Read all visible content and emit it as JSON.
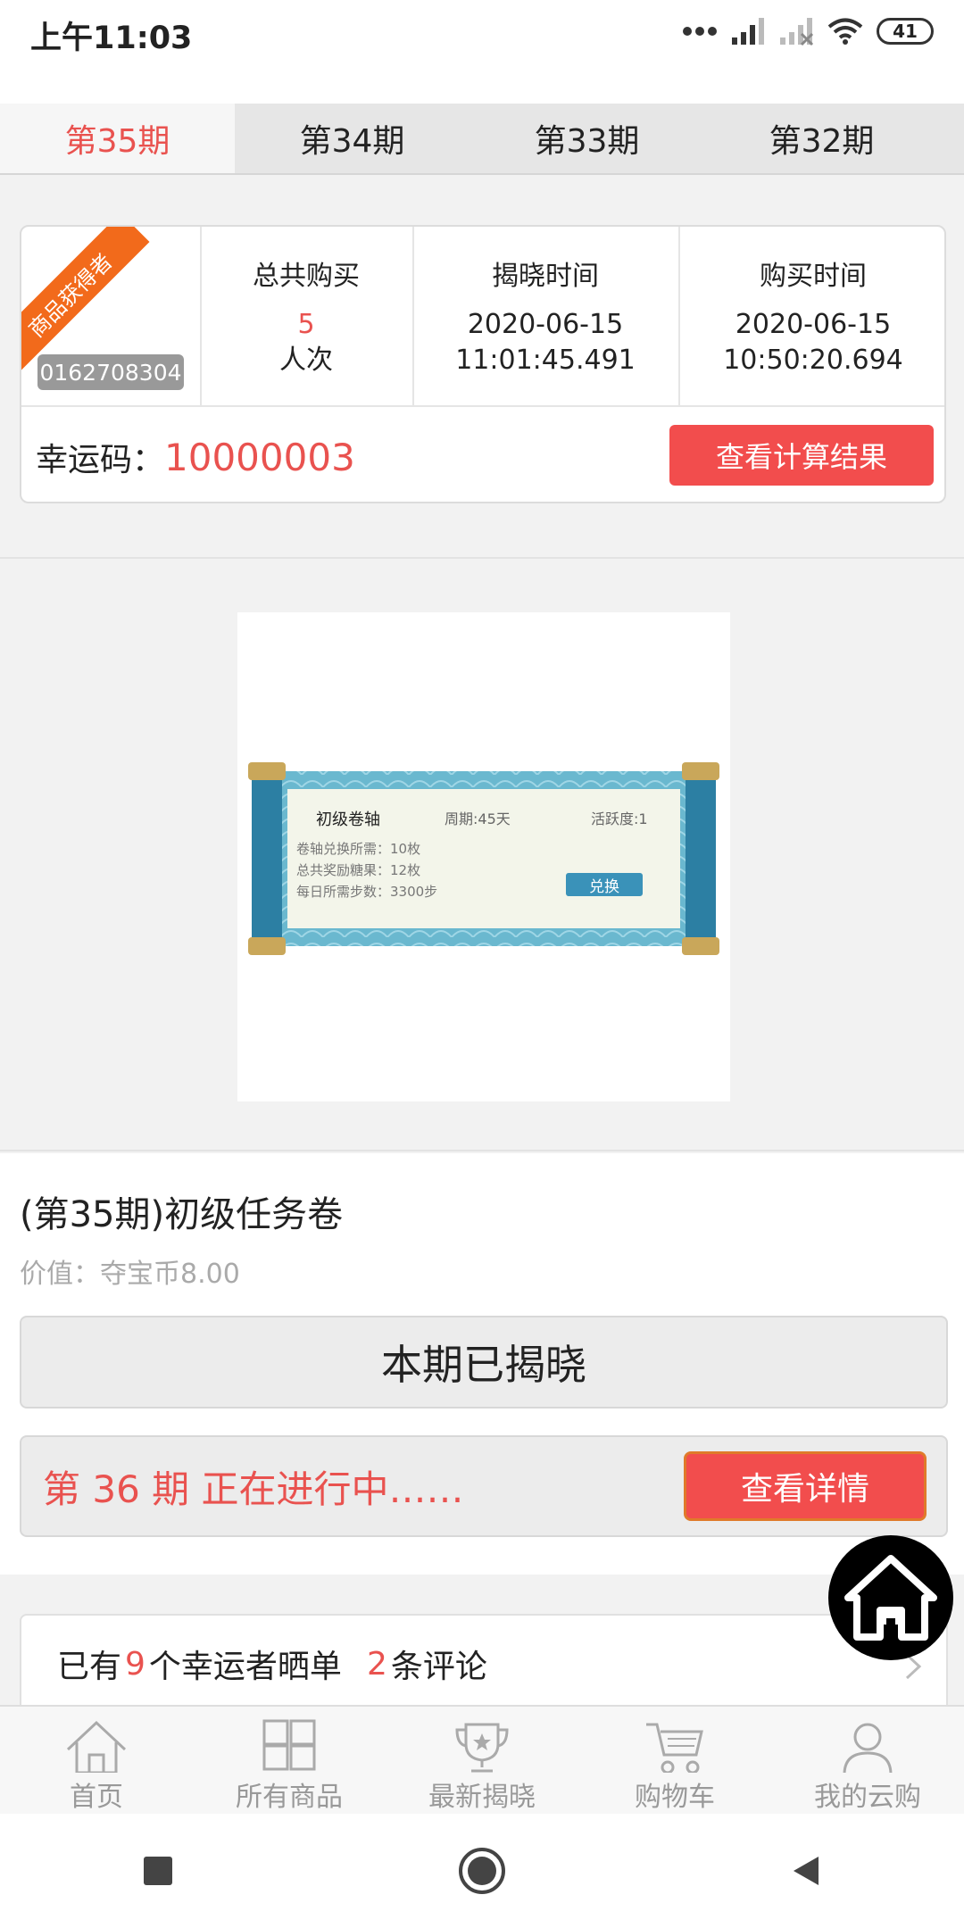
{
  "status": {
    "time": "上午11:03",
    "battery": "41"
  },
  "tabs": [
    {
      "label": "第35期",
      "active": true
    },
    {
      "label": "第34期",
      "active": false
    },
    {
      "label": "第33期",
      "active": false
    },
    {
      "label": "第32期",
      "active": false
    }
  ],
  "winner": {
    "ribbon": "商品获得者",
    "user_id": "0162708304",
    "total_buy_label": "总共购买",
    "total_buy_count": "5",
    "total_buy_unit": "人次",
    "reveal_label": "揭晓时间",
    "reveal_date": "2020-06-15",
    "reveal_time": "11:01:45.491",
    "buy_label": "购买时间",
    "buy_date": "2020-06-15",
    "buy_time": "10:50:20.694",
    "lucky_label": "幸运码：",
    "lucky_code": "10000003",
    "calc_button": "查看计算结果"
  },
  "product_image": {
    "name": "初级卷轴",
    "period": "周期:45天",
    "activity": "活跃度:1",
    "line1": "卷轴兑换所需：10枚",
    "line2": "总共奖励糖果：12枚",
    "line3": "每日所需步数：3300步",
    "exchange": "兑换"
  },
  "product": {
    "title": "(第35期)初级任务卷",
    "price": "价值：夺宝币8.00",
    "revealed": "本期已揭晓",
    "ongoing": "第 36 期 正在进行中……",
    "detail_button": "查看详情"
  },
  "share": {
    "prefix": "已有",
    "count": "9",
    "mid": "个幸运者晒单",
    "comments": "2",
    "suffix": "条评论"
  },
  "nav": [
    {
      "label": "首页",
      "icon": "home-icon"
    },
    {
      "label": "所有商品",
      "icon": "grid-icon"
    },
    {
      "label": "最新揭晓",
      "icon": "trophy-icon"
    },
    {
      "label": "购物车",
      "icon": "cart-icon"
    },
    {
      "label": "我的云购",
      "icon": "user-icon"
    }
  ],
  "colors": {
    "accent": "#e9524f",
    "button": "#f24d4d",
    "ribbon": "#f26a1b"
  }
}
